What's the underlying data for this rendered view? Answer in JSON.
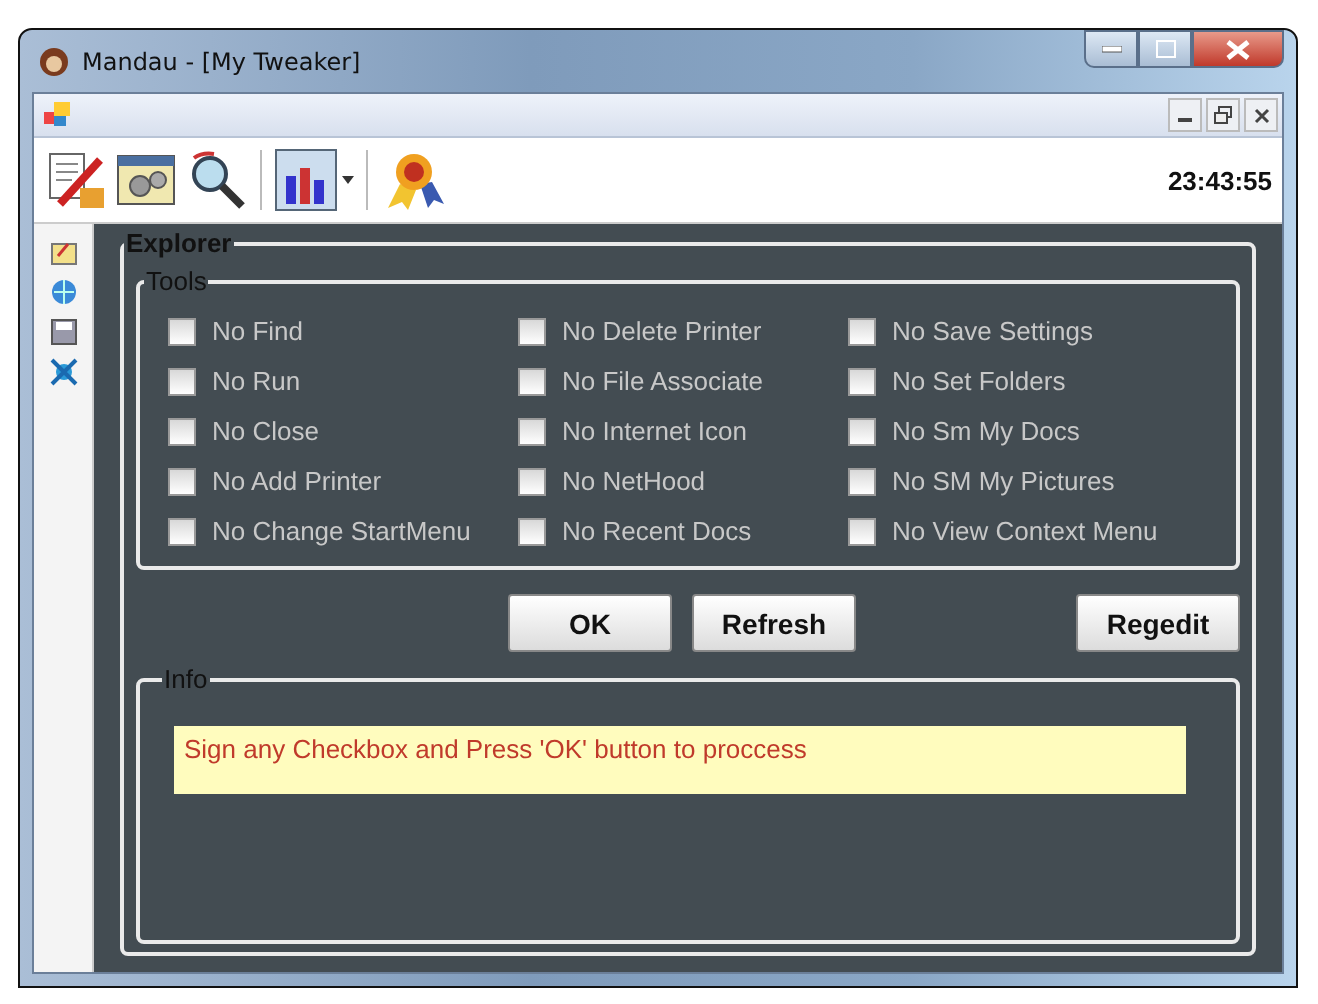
{
  "window": {
    "title": "Mandau - [My Tweaker]"
  },
  "toolbar": {
    "clock": "23:43:55"
  },
  "explorer": {
    "title": "Explorer",
    "tools": {
      "title": "Tools",
      "checkboxes": [
        {
          "label": "No Find",
          "checked": false
        },
        {
          "label": "No Delete Printer",
          "checked": false
        },
        {
          "label": "No Save Settings",
          "checked": false
        },
        {
          "label": "No Run",
          "checked": false
        },
        {
          "label": "No File Associate",
          "checked": false
        },
        {
          "label": "No Set Folders",
          "checked": false
        },
        {
          "label": "No Close",
          "checked": false
        },
        {
          "label": "No Internet Icon",
          "checked": false
        },
        {
          "label": "No Sm My Docs",
          "checked": false
        },
        {
          "label": "No Add Printer",
          "checked": false
        },
        {
          "label": "No NetHood",
          "checked": false
        },
        {
          "label": "No SM My Pictures",
          "checked": false
        },
        {
          "label": "No Change StartMenu",
          "checked": false
        },
        {
          "label": "No Recent Docs",
          "checked": false
        },
        {
          "label": "No View Context Menu",
          "checked": false
        }
      ]
    },
    "buttons": [
      "OK",
      "Refresh",
      "Regedit"
    ],
    "info": {
      "title": "Info",
      "message": "Sign any Checkbox and Press 'OK' button to proccess"
    }
  }
}
